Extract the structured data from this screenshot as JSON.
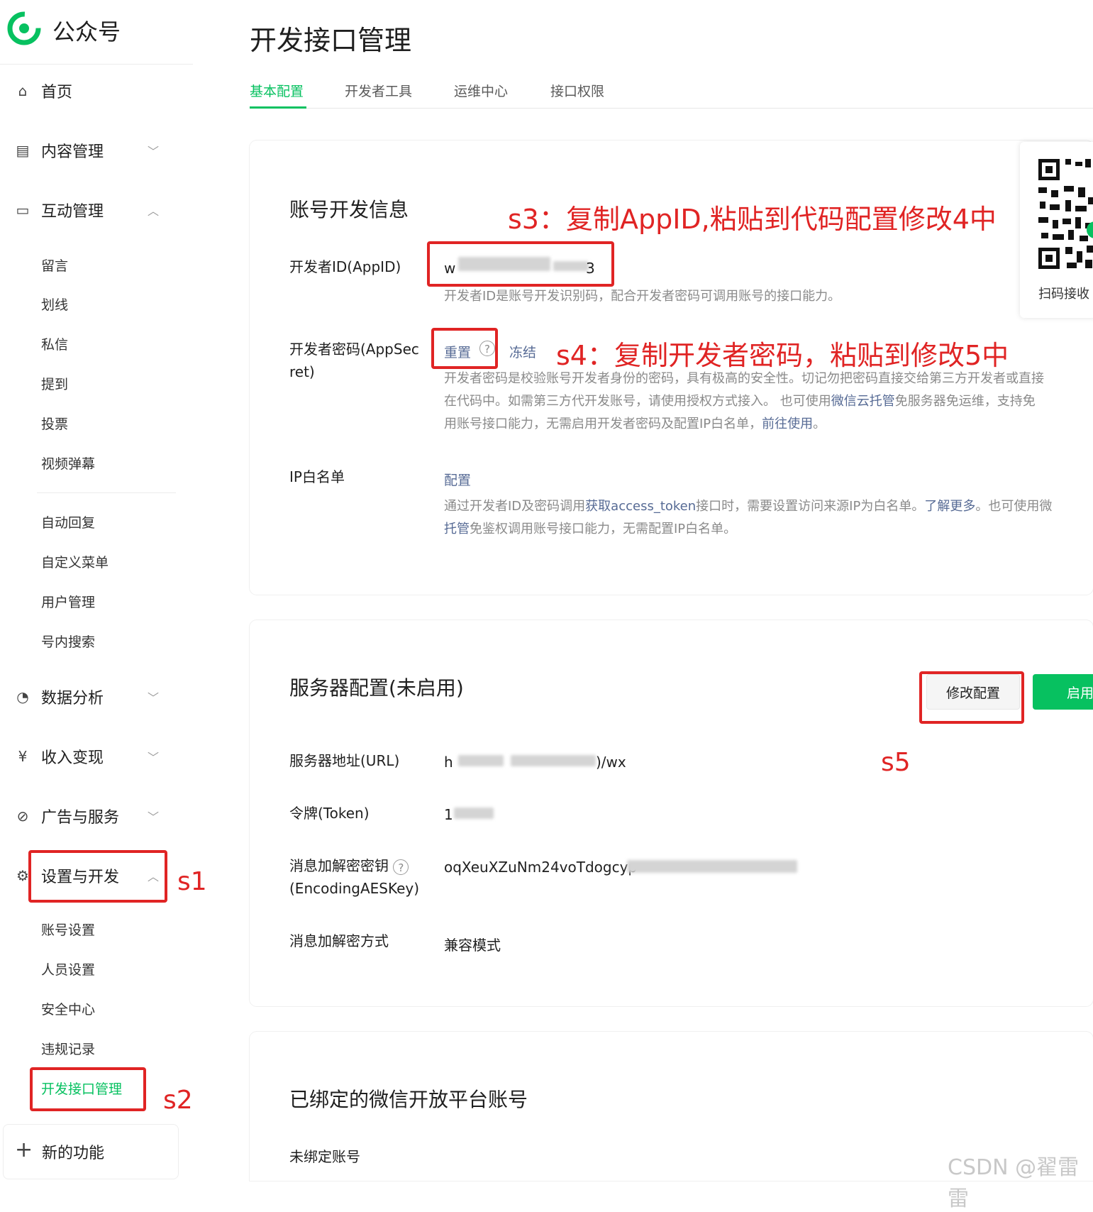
{
  "app": {
    "name": "公众号"
  },
  "sidebar": {
    "home": "首页",
    "content": "内容管理",
    "interaction": "互动管理",
    "interaction_items": [
      "留言",
      "划线",
      "私信",
      "提到",
      "投票",
      "视频弹幕"
    ],
    "interaction_items2": [
      "自动回复",
      "自定义菜单",
      "用户管理",
      "号内搜索"
    ],
    "data": "数据分析",
    "income": "收入变现",
    "ads": "广告与服务",
    "settings": "设置与开发",
    "settings_items": [
      "账号设置",
      "人员设置",
      "安全中心",
      "违规记录",
      "开发接口管理"
    ],
    "new_features": "新的功能"
  },
  "main": {
    "title": "开发接口管理",
    "tabs": [
      "基本配置",
      "开发者工具",
      "运维中心",
      "接口权限"
    ],
    "account_section": {
      "title": "账号开发信息",
      "appid_label": "开发者ID(AppID)",
      "appid_prefix": "w",
      "appid_suffix": "3",
      "appid_desc": "开发者ID是账号开发识别码，配合开发者密码可调用账号的接口能力。",
      "secret_label_1": "开发者密码(AppSec",
      "secret_label_2": "ret)",
      "reset": "重置",
      "freeze": "冻结",
      "secret_desc_1": "开发者密码是校验账号开发者身份的密码，具有极高的安全性。切记勿把密码直接交给第三方开发者或直接",
      "secret_desc_2a": "在代码中。如需第三方代开发账号，请使用授权方式接入。 也可使用",
      "secret_desc_2link": "微信云托管",
      "secret_desc_2b": "免服务器免运维，支持免",
      "secret_desc_3a": "用账号接口能力，无需启用开发者密码及配置IP白名单，",
      "secret_desc_3link": "前往使用",
      "secret_desc_3b": "。",
      "ip_label": "IP白名单",
      "ip_config": "配置",
      "ip_desc_1a": "通过开发者ID及密码调用",
      "ip_desc_1link": "获取access_token",
      "ip_desc_1b": "接口时，需要设置访问来源IP为白名单。",
      "ip_desc_1link2": "了解更多",
      "ip_desc_1c": "。也可使用微",
      "ip_desc_2link": "托管",
      "ip_desc_2b": "免鉴权调用账号接口能力，无需配置IP白名单。",
      "qr_label": "扫码接收"
    },
    "server_section": {
      "title": "服务器配置(未启用)",
      "modify_button": "修改配置",
      "enable_button": "启用",
      "url_label": "服务器地址(URL)",
      "url_prefix": "h",
      "url_suffix": ")/wx",
      "token_label": "令牌(Token)",
      "token_prefix": "1",
      "aes_label_1": "消息加解密密钥",
      "aes_label_2": "(EncodingAESKey)",
      "aes_value": "oqXeuXZuNm24voTdogcyp",
      "mode_label": "消息加解密方式",
      "mode_value": "兼容模式"
    },
    "bound_section": {
      "title": "已绑定的微信开放平台账号",
      "status": "未绑定账号"
    }
  },
  "annotations": {
    "s1": "s1",
    "s2": "s2",
    "s3": "s3：复制AppID,粘贴到代码配置修改4中",
    "s4": "s4：复制开发者密码，粘贴到修改5中",
    "s5": "s5"
  },
  "watermark": "CSDN @翟雷雷",
  "colors": {
    "accent": "#07c160",
    "link": "#576b95",
    "annotation": "#e02424"
  }
}
